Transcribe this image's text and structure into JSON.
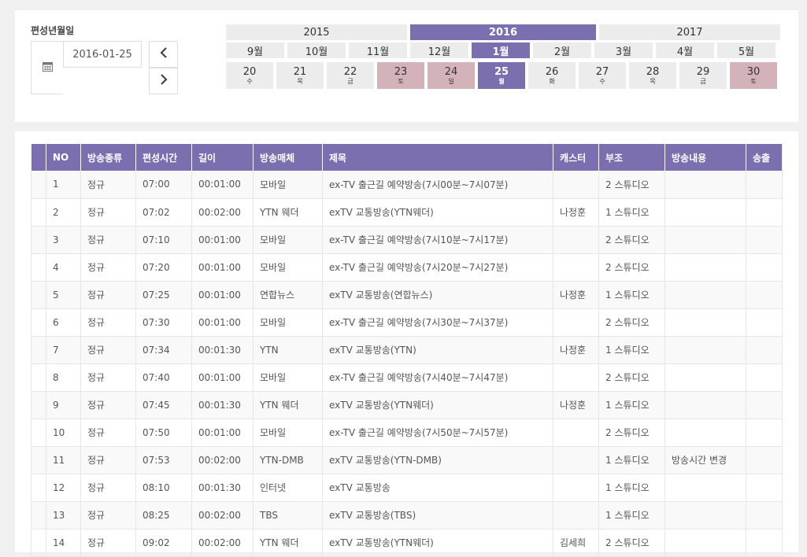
{
  "picker": {
    "label": "편성년월일",
    "date_value": "2016-01-25",
    "prev_icon": "chevron-left-icon",
    "next_icon": "chevron-right-icon",
    "calendar_icon": "calendar-icon"
  },
  "years": [
    {
      "label": "2015",
      "active": false
    },
    {
      "label": "2016",
      "active": true
    },
    {
      "label": "2017",
      "active": false
    }
  ],
  "months": [
    {
      "label": "9월",
      "active": false
    },
    {
      "label": "10월",
      "active": false
    },
    {
      "label": "11월",
      "active": false
    },
    {
      "label": "12월",
      "active": false
    },
    {
      "label": "1월",
      "active": true
    },
    {
      "label": "2월",
      "active": false
    },
    {
      "label": "3월",
      "active": false
    },
    {
      "label": "4월",
      "active": false
    },
    {
      "label": "5월",
      "active": false
    }
  ],
  "days": [
    {
      "num": "20",
      "wd": "수",
      "state": "normal"
    },
    {
      "num": "21",
      "wd": "목",
      "state": "normal"
    },
    {
      "num": "22",
      "wd": "금",
      "state": "normal"
    },
    {
      "num": "23",
      "wd": "토",
      "state": "weekend"
    },
    {
      "num": "24",
      "wd": "일",
      "state": "weekend"
    },
    {
      "num": "25",
      "wd": "월",
      "state": "active"
    },
    {
      "num": "26",
      "wd": "화",
      "state": "normal"
    },
    {
      "num": "27",
      "wd": "수",
      "state": "normal"
    },
    {
      "num": "28",
      "wd": "목",
      "state": "normal"
    },
    {
      "num": "29",
      "wd": "금",
      "state": "normal"
    },
    {
      "num": "30",
      "wd": "토",
      "state": "weekend"
    }
  ],
  "colors": {
    "accent": "#7b6fb0",
    "weekend": "#d4b2ba",
    "cell": "#ececec"
  },
  "table": {
    "headers": [
      "",
      "NO",
      "방송종류",
      "편성시간",
      "길이",
      "방송매체",
      "제목",
      "캐스터",
      "부조",
      "방송내용",
      "송출"
    ],
    "rows": [
      [
        "",
        "1",
        "정규",
        "07:00",
        "00:01:00",
        "모바일",
        "ex-TV 출근길 예약방송(7시00분~7시07분)",
        "",
        "2 스튜디오",
        "",
        ""
      ],
      [
        "",
        "2",
        "정규",
        "07:02",
        "00:02:00",
        "YTN 웨더",
        "exTV 교통방송(YTN웨더)",
        "나정훈",
        "1 스튜디오",
        "",
        ""
      ],
      [
        "",
        "3",
        "정규",
        "07:10",
        "00:01:00",
        "모바일",
        "ex-TV 출근길 예약방송(7시10분~7시17분)",
        "",
        "2 스튜디오",
        "",
        ""
      ],
      [
        "",
        "4",
        "정규",
        "07:20",
        "00:01:00",
        "모바일",
        "ex-TV 출근길 예약방송(7시20분~7시27분)",
        "",
        "2 스튜디오",
        "",
        ""
      ],
      [
        "",
        "5",
        "정규",
        "07:25",
        "00:01:00",
        "연합뉴스",
        "exTV 교통방송(연합뉴스)",
        "나정훈",
        "1 스튜디오",
        "",
        ""
      ],
      [
        "",
        "6",
        "정규",
        "07:30",
        "00:01:00",
        "모바일",
        "ex-TV 출근길 예약방송(7시30분~7시37분)",
        "",
        "2 스튜디오",
        "",
        ""
      ],
      [
        "",
        "7",
        "정규",
        "07:34",
        "00:01:30",
        "YTN",
        "exTV 교통방송(YTN)",
        "나정훈",
        "1 스튜디오",
        "",
        ""
      ],
      [
        "",
        "8",
        "정규",
        "07:40",
        "00:01:00",
        "모바일",
        "ex-TV 출근길 예약방송(7시40분~7시47분)",
        "",
        "2 스튜디오",
        "",
        ""
      ],
      [
        "",
        "9",
        "정규",
        "07:45",
        "00:01:30",
        "YTN 웨더",
        "exTV 교통방송(YTN웨더)",
        "나정훈",
        "1 스튜디오",
        "",
        ""
      ],
      [
        "",
        "10",
        "정규",
        "07:50",
        "00:01:00",
        "모바일",
        "ex-TV 출근길 예약방송(7시50분~7시57분)",
        "",
        "2 스튜디오",
        "",
        ""
      ],
      [
        "",
        "11",
        "정규",
        "07:53",
        "00:02:00",
        "YTN-DMB",
        "exTV 교통방송(YTN-DMB)",
        "",
        "1 스튜디오",
        "방송시간 변경",
        ""
      ],
      [
        "",
        "12",
        "정규",
        "08:10",
        "00:01:30",
        "인터넷",
        "exTV 교통방송",
        "",
        "1 스튜디오",
        "",
        ""
      ],
      [
        "",
        "13",
        "정규",
        "08:25",
        "00:02:00",
        "TBS",
        "exTV 교통방송(TBS)",
        "",
        "1 스튜디오",
        "",
        ""
      ],
      [
        "",
        "14",
        "정규",
        "09:02",
        "00:02:00",
        "YTN 웨더",
        "exTV 교통방송(YTN웨더)",
        "김세희",
        "2 스튜디오",
        "",
        ""
      ]
    ]
  }
}
